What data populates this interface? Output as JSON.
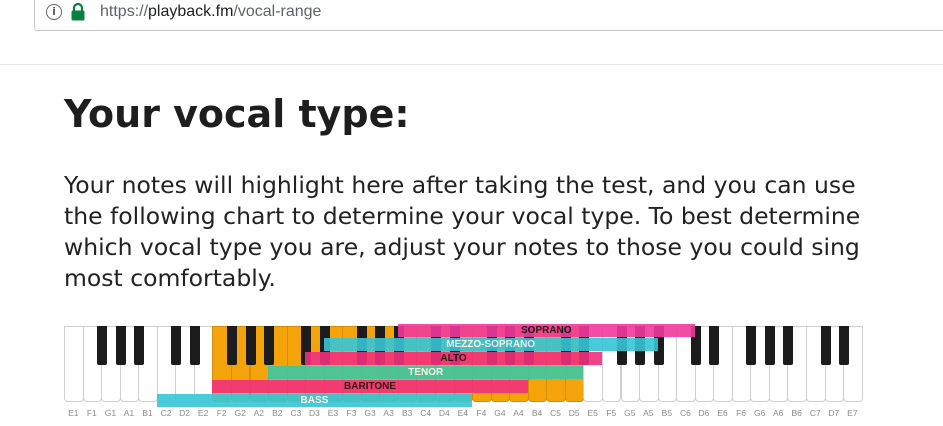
{
  "browser": {
    "url_scheme": "https://",
    "url_domain": "playback.fm",
    "url_path": "/vocal-range"
  },
  "page": {
    "title": "Your vocal type:",
    "intro": "Your notes will highlight here after taking the test, and you can use the following chart to determine your vocal type. To best determine which vocal type you are, adjust your notes to those you could sing most comfortably."
  },
  "chart_data": {
    "type": "piano-range",
    "keys": [
      "E1",
      "F1",
      "G1",
      "A1",
      "B1",
      "C2",
      "D2",
      "E2",
      "F2",
      "G2",
      "A2",
      "B2",
      "C3",
      "D3",
      "E3",
      "F3",
      "G3",
      "A3",
      "B3",
      "C4",
      "D4",
      "E4",
      "F4",
      "G4",
      "A4",
      "B4",
      "C5",
      "D5",
      "E5",
      "F5",
      "G5",
      "A5",
      "B5",
      "C6",
      "D6",
      "E6",
      "F6",
      "G6",
      "A6",
      "B6",
      "C7",
      "D7",
      "E7"
    ],
    "highlighted_range": [
      "F2",
      "D5"
    ],
    "highlight_color": "#f5a30a",
    "ranges": [
      {
        "name": "SOPRANO",
        "from": "B3",
        "to": "C6",
        "color": "#f13a9c",
        "text_color": "#111111"
      },
      {
        "name": "MEZZO-SOPRANO",
        "from": "E3",
        "to": "A5",
        "color": "#36c5d6",
        "text_color": "#ffffff"
      },
      {
        "name": "ALTO",
        "from": "D3",
        "to": "E5",
        "color": "#f2307c",
        "text_color": "#111111"
      },
      {
        "name": "TENOR",
        "from": "B2",
        "to": "D5",
        "color": "#3ec6a2",
        "text_color": "#ffffff"
      },
      {
        "name": "BARITONE",
        "from": "F2",
        "to": "A4",
        "color": "#f2307c",
        "text_color": "#111111"
      },
      {
        "name": "BASS",
        "from": "C2",
        "to": "E4",
        "color": "#36c5d6",
        "text_color": "#ffffff"
      }
    ]
  }
}
